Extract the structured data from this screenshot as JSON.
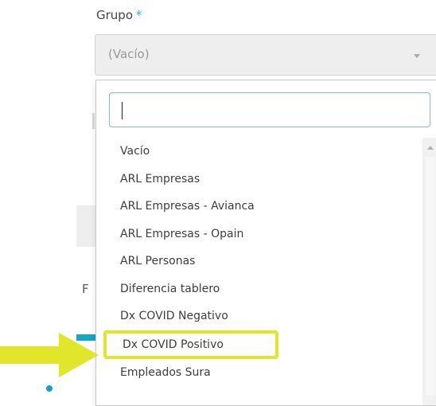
{
  "field": {
    "label": "Grupo",
    "required_mark": "*",
    "selected_value": "(Vacío)"
  },
  "background": {
    "partial_letter": "F"
  },
  "dropdown": {
    "search_value": "",
    "options": [
      "Vacío",
      "ARL Empresas",
      "ARL Empresas - Avianca",
      "ARL Empresas - Opain",
      "ARL Personas",
      "Diferencia tablero",
      "Dx COVID Negativo",
      "Dx COVID Positivo",
      "Empleados Sura"
    ],
    "highlighted_option": "Dx COVID Positivo"
  },
  "annotation": {
    "arrow_color": "#e2e62b",
    "highlight_color": "#e2e62b"
  },
  "colors": {
    "required": "#29b6d3",
    "accent_teal": "#18a7be",
    "focus_border": "#8ab4e0"
  }
}
